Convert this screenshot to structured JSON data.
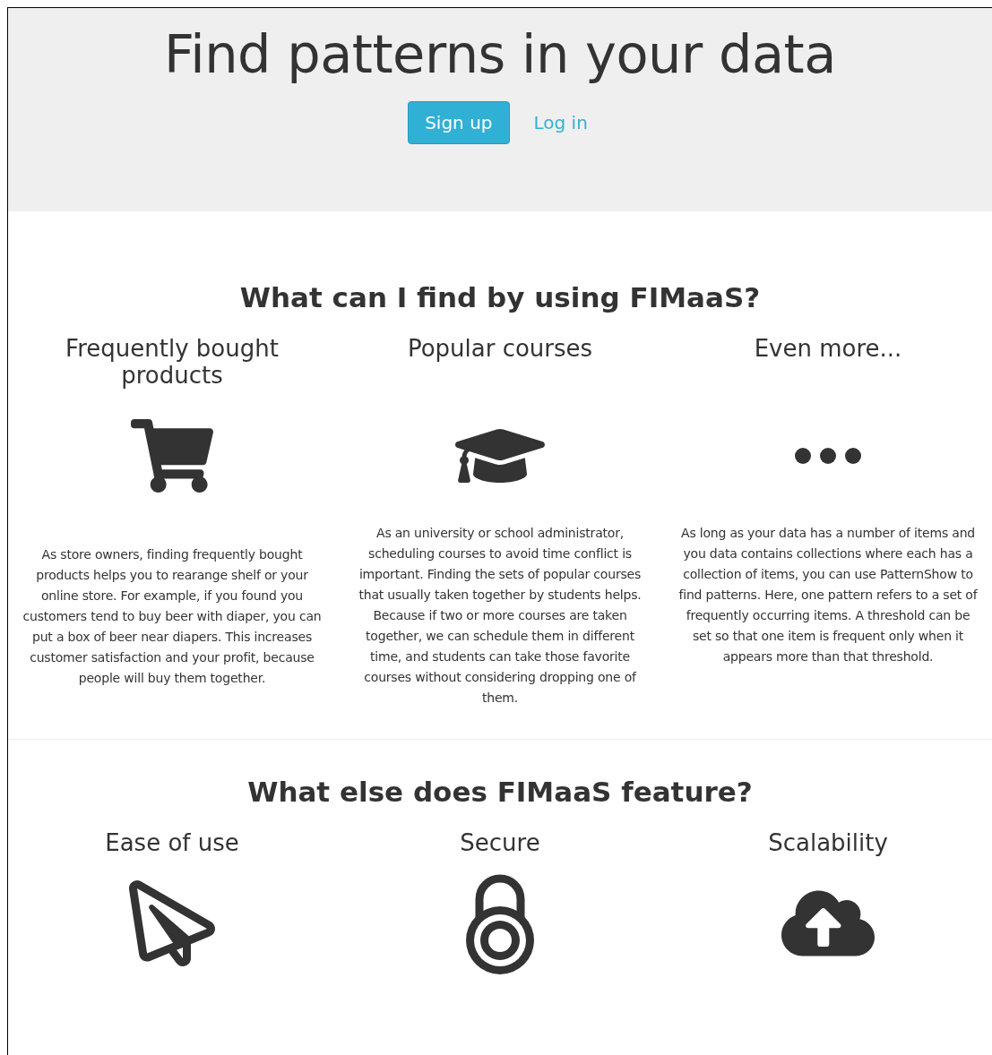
{
  "hero": {
    "title": "Find patterns in your data",
    "buttons": [
      {
        "kind": "primary",
        "label": "Sign up"
      },
      {
        "kind": "link",
        "label": "Log in"
      }
    ]
  },
  "sections": [
    {
      "heading": "What can I find by using FIMaaS?",
      "features": [
        {
          "title": "Frequently bought products",
          "text": "As store owners, finding frequently bought products helps you to rearange shelf or your online store. For example, if you found you customers tend to buy beer with diaper, you can put a box of beer near diapers. This increases customer satisfaction and your profit, because people will buy them together."
        },
        {
          "title": "Popular courses",
          "text": "As an university or school administrator, scheduling courses to avoid time conflict is important. Finding the sets of popular courses that usually taken together by students helps. Because if two or more courses are taken together, we can schedule them in different time, and students can take those favorite courses without considering dropping one of them."
        },
        {
          "title": "Even more...",
          "text": "As long as your data has a number of items and you data contains collections where each has a collection of items, you can use PatternShow to find patterns. Here, one pattern refers to a set of frequently occurring items. A threshold can be set so that one item is frequent only when it appears more than that threshold."
        }
      ]
    },
    {
      "heading": "What else does FIMaaS feature?",
      "features": [
        {
          "title": "Ease of use"
        },
        {
          "title": "Secure"
        },
        {
          "title": "Scalability"
        }
      ]
    }
  ]
}
